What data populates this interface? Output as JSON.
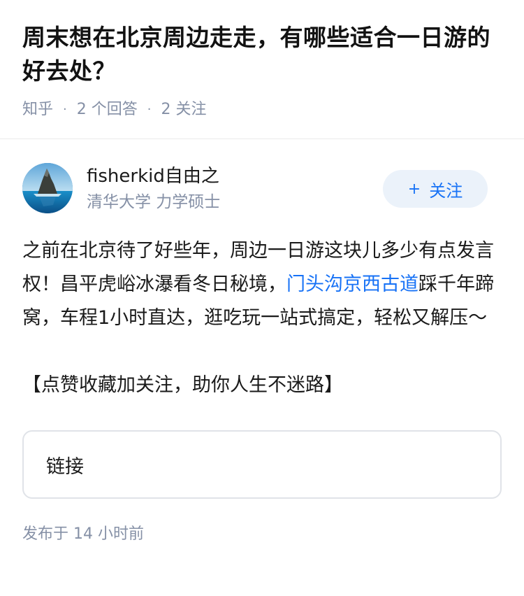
{
  "question": {
    "title": "周末想在北京周边走走，有哪些适合一日游的好去处？",
    "source": "知乎",
    "answers_count": "2 个回答",
    "followers_count": "2 关注"
  },
  "answer": {
    "author": {
      "name": "fisherkid自由之",
      "bio": "清华大学 力学硕士",
      "avatar_icon": "rock-island-avatar"
    },
    "follow_button": {
      "icon": "plus-icon",
      "label": "关注"
    },
    "content": {
      "paragraph_before_link": "之前在北京待了好些年，周边一日游这块儿多少有点发言权！昌平虎峪冰瀑看冬日秘境，",
      "link_text": "门头沟京西古道",
      "paragraph_after_link": "踩千年蹄窝，车程1小时直达，逛吃玩一站式搞定，轻松又解压～",
      "slogan": "【点赞收藏加关注，助你人生不迷路】"
    },
    "link_card_label": "链接",
    "publish_time": "发布于 14 小时前"
  },
  "colors": {
    "accent": "#1772f6",
    "meta_gray": "#8590a6",
    "follow_bg": "#ebf2fa"
  }
}
